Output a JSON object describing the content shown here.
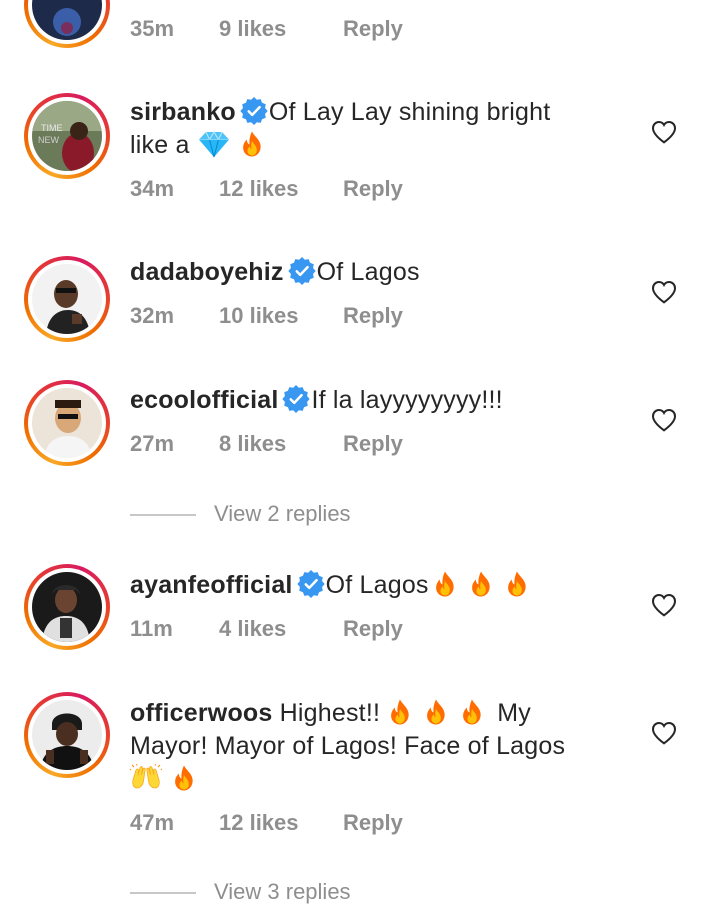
{
  "partial_comment": {
    "time": "35m",
    "likes": "9 likes",
    "reply_label": "Reply"
  },
  "comments": [
    {
      "username": "sirbanko",
      "verified": true,
      "text_lines": [
        "Of Lay Lay shining bright",
        "like a"
      ],
      "emojis": [
        "gem-stone-emoji",
        "fire-emoji"
      ],
      "time": "34m",
      "likes": "12 likes",
      "reply_label": "Reply"
    },
    {
      "username": "dadaboyehiz",
      "verified": true,
      "text": "Of Lagos",
      "time": "32m",
      "likes": "10 likes",
      "reply_label": "Reply"
    },
    {
      "username": "ecoolofficial",
      "verified": true,
      "text": "If la layyyyyyyy!!!",
      "time": "27m",
      "likes": "8 likes",
      "reply_label": "Reply",
      "view_replies": "View 2 replies"
    },
    {
      "username": "ayanfeofficial",
      "verified": true,
      "text": "Of Lagos",
      "emojis": [
        "fire-emoji",
        "fire-emoji",
        "fire-emoji"
      ],
      "time": "11m",
      "likes": "4 likes",
      "reply_label": "Reply"
    },
    {
      "username": "officerwoos",
      "verified": false,
      "text_parts": [
        "Highest!!",
        "My",
        "Mayor! Mayor of Lagos! Face of Lagos"
      ],
      "emojis": [
        "fire-emoji",
        "fire-emoji",
        "fire-emoji",
        "raising-hands-emoji",
        "fire-emoji"
      ],
      "time": "47m",
      "likes": "12 likes",
      "reply_label": "Reply",
      "view_replies": "View 3 replies"
    }
  ],
  "icons": {
    "like": "heart-outline-icon",
    "verified": "verified-badge-icon"
  },
  "colors": {
    "text": "#262626",
    "meta": "#8e8e8e",
    "verified_blue": "#3897f0",
    "story_ring_start": "#f9a825",
    "story_ring_end": "#d81b60"
  }
}
